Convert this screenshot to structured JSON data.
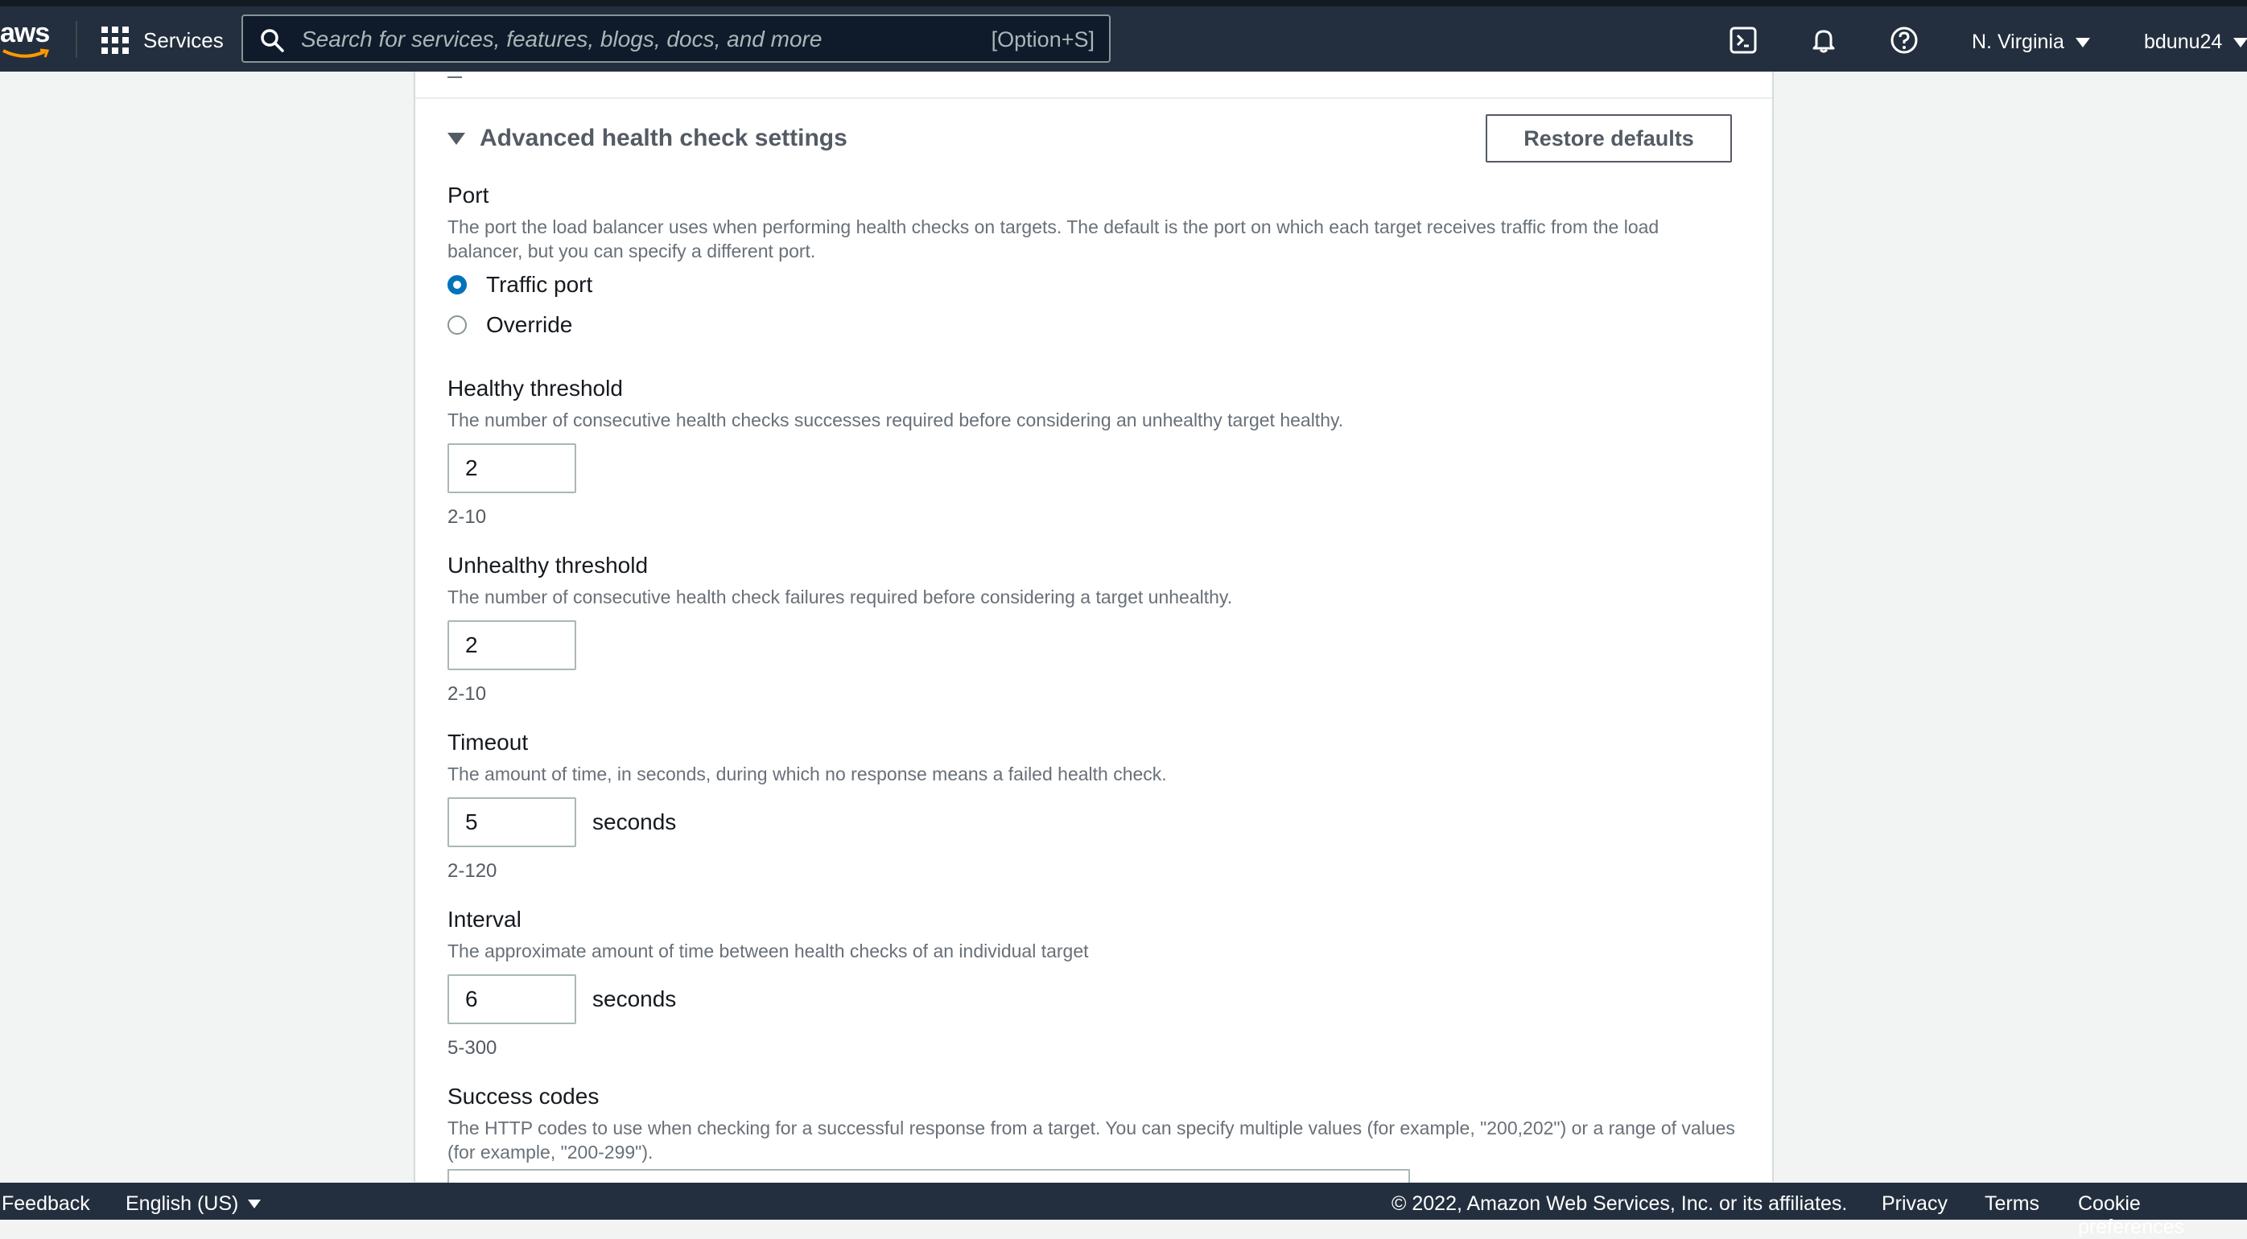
{
  "topnav": {
    "logo_text": "aws",
    "services_label": "Services",
    "search": {
      "placeholder": "Search for services, features, blogs, docs, and more",
      "shortcut": "[Option+S]"
    },
    "region": "N. Virginia",
    "user": "bdunu24",
    "icons": [
      "grid-icon",
      "search-icon",
      "cloudshell-icon",
      "bell-icon",
      "help-icon",
      "caret-down-icon"
    ]
  },
  "advanced": {
    "title": "Advanced health check settings",
    "restore_label": "Restore defaults",
    "port": {
      "label": "Port",
      "description": "The port the load balancer uses when performing health checks on targets. The default is the port on which each target receives traffic from the load balancer, but you can specify a different port.",
      "options": [
        "Traffic port",
        "Override"
      ],
      "selected": "Traffic port"
    },
    "healthy": {
      "label": "Healthy threshold",
      "description": "The number of consecutive health checks successes required before considering an unhealthy target healthy.",
      "value": "2",
      "hint": "2-10"
    },
    "unhealthy": {
      "label": "Unhealthy threshold",
      "description": "The number of consecutive health check failures required before considering a target unhealthy.",
      "value": "2",
      "hint": "2-10"
    },
    "timeout": {
      "label": "Timeout",
      "description": "The amount of time, in seconds, during which no response means a failed health check.",
      "value": "5",
      "unit": "seconds",
      "hint": "2-120"
    },
    "interval": {
      "label": "Interval",
      "description": "The approximate amount of time between health checks of an individual target",
      "value": "6",
      "unit": "seconds",
      "hint": "5-300"
    },
    "success_codes": {
      "label": "Success codes",
      "description": "The HTTP codes to use when checking for a successful response from a target. You can specify multiple values (for example, \"200,202\") or a range of values (for example, \"200-299\")."
    }
  },
  "footer": {
    "feedback": "Feedback",
    "language": "English (US)",
    "copyright": "© 2022, Amazon Web Services, Inc. or its affiliates.",
    "privacy": "Privacy",
    "terms": "Terms",
    "cookies": "Cookie preferences"
  },
  "colors": {
    "nav_bg": "#232f3e",
    "accent": "#0073bb",
    "page_bg": "#f2f3f3"
  }
}
